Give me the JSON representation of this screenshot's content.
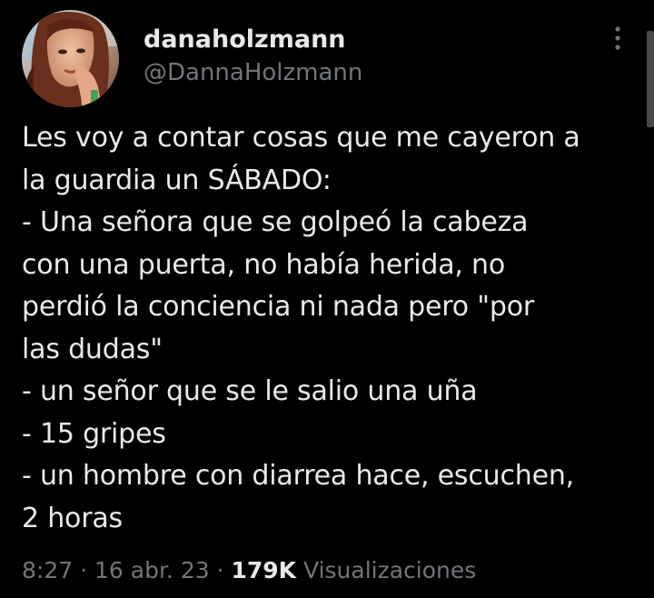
{
  "author": {
    "display_name": "danaholzmann",
    "handle": "@DannaHolzmann"
  },
  "more_icon": "more-vertical-icon",
  "tweet": {
    "lines": [
      "Les voy a contar cosas que me cayeron a",
      "la guardia un SÁBADO:",
      "- Una señora que se golpeó la cabeza",
      "con una puerta, no había herida, no",
      "perdió la conciencia ni nada pero \"por",
      "las dudas\"",
      "- un señor que se le salio una uña",
      "- 15 gripes",
      "- un hombre con diarrea hace, escuchen,",
      "2 horas"
    ]
  },
  "meta": {
    "time": "8:27",
    "separator": "·",
    "date": "16 abr. 23",
    "views_count": "179K",
    "views_label": "Visualizaciones"
  },
  "colors": {
    "background": "#000000",
    "primary_text": "#e7e9ea",
    "secondary_text": "#71767b"
  }
}
